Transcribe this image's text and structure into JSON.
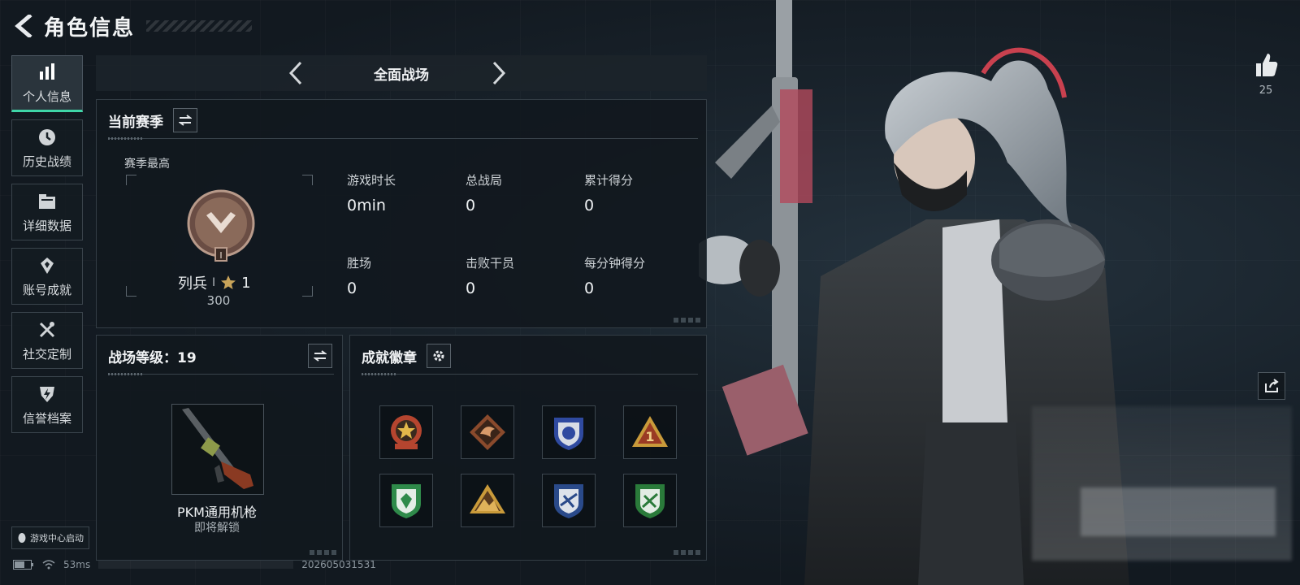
{
  "header": {
    "title": "角色信息"
  },
  "sidebar": {
    "items": [
      {
        "label": "个人信息",
        "icon": "bar-chart-icon",
        "active": true
      },
      {
        "label": "历史战绩",
        "icon": "clock-icon"
      },
      {
        "label": "详细数据",
        "icon": "folder-icon"
      },
      {
        "label": "账号成就",
        "icon": "achievement-icon"
      },
      {
        "label": "社交定制",
        "icon": "tools-icon"
      },
      {
        "label": "信誉档案",
        "icon": "shield-bolt-icon"
      }
    ],
    "launch_label": "游戏中心启动"
  },
  "status": {
    "ping": "53ms",
    "id": "202605031531"
  },
  "mode_bar": {
    "title": "全面战场"
  },
  "season": {
    "title": "当前赛季",
    "subtitle": "赛季最高",
    "rank_name": "列兵",
    "rank_divider": "I",
    "rank_stars": "1",
    "rank_score": "300",
    "emblem_numeral": "I",
    "stats": [
      {
        "label": "游戏时长",
        "value": "0min"
      },
      {
        "label": "总战局",
        "value": "0"
      },
      {
        "label": "累计得分",
        "value": "0"
      },
      {
        "label": "胜场",
        "value": "0"
      },
      {
        "label": "击败干员",
        "value": "0"
      },
      {
        "label": "每分钟得分",
        "value": "0"
      }
    ]
  },
  "battle_level": {
    "title": "战场等级：19",
    "weapon_name": "PKM通用机枪",
    "weapon_status": "即将解锁"
  },
  "achievements": {
    "title": "成就徽章",
    "badges": [
      {
        "icon": "star-emblem-icon",
        "color": "#b5452f"
      },
      {
        "icon": "dragon-emblem-icon",
        "color": "#8a4a2c"
      },
      {
        "icon": "shield-blue-emblem-icon",
        "color": "#2f4aa0"
      },
      {
        "icon": "triangle-one-emblem-icon",
        "color": "#9a3a24",
        "text": "1"
      },
      {
        "icon": "shield-green-emblem-icon",
        "color": "#2f8a4a"
      },
      {
        "icon": "mountain-emblem-icon",
        "color": "#9a5a2a"
      },
      {
        "icon": "shield-blue-wing-emblem-icon",
        "color": "#2a4a8a"
      },
      {
        "icon": "shield-green-rifle-emblem-icon",
        "color": "#2a7a3a"
      }
    ]
  },
  "social": {
    "like_count": "25"
  },
  "colors": {
    "accent": "#3fd6a8",
    "panel_border": "#333d45",
    "bronze": "#8a6a5a"
  }
}
